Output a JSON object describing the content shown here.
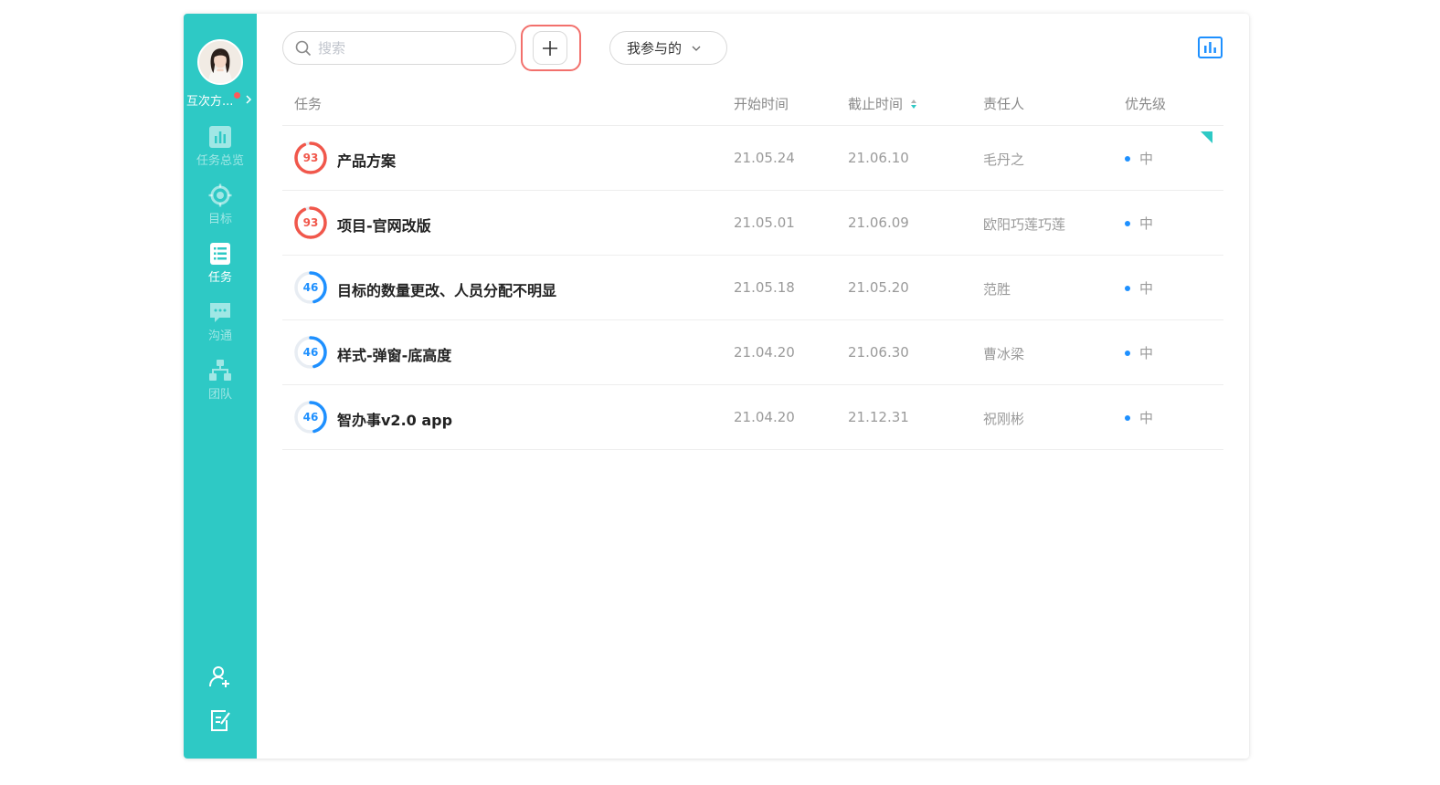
{
  "colors": {
    "sidebar": "#2ec9c5",
    "accent": "#1e90ff",
    "danger": "#f1574b",
    "highlight": "#f2706c",
    "priority_dot": "#1e90ff"
  },
  "sidebar": {
    "user_name": "互次方...",
    "nav": [
      {
        "label": "任务总览",
        "icon": "chart-icon",
        "active": false
      },
      {
        "label": "目标",
        "icon": "target-icon",
        "active": false
      },
      {
        "label": "任务",
        "icon": "task-list-icon",
        "active": true
      },
      {
        "label": "沟通",
        "icon": "chat-icon",
        "active": false
      },
      {
        "label": "团队",
        "icon": "team-icon",
        "active": false
      }
    ],
    "bottom_icons": [
      "add-person-icon",
      "edit-note-icon"
    ]
  },
  "toolbar": {
    "search_placeholder": "搜索",
    "search_value": "",
    "filter_label": "我参与的"
  },
  "table": {
    "columns": {
      "task": "任务",
      "start": "开始时间",
      "end": "截止时间",
      "owner": "责任人",
      "priority": "优先级"
    },
    "rows": [
      {
        "progress": 93,
        "progress_color": "#f1574b",
        "name": "产品方案",
        "start": "21.05.24",
        "end": "21.06.10",
        "owner": "毛丹之",
        "priority": "中"
      },
      {
        "progress": 93,
        "progress_color": "#f1574b",
        "name": "项目-官网改版",
        "start": "21.05.01",
        "end": "21.06.09",
        "owner": "欧阳巧莲巧莲",
        "priority": "中"
      },
      {
        "progress": 46,
        "progress_color": "#1e90ff",
        "name": "目标的数量更改、人员分配不明显",
        "start": "21.05.18",
        "end": "21.05.20",
        "owner": "范胜",
        "priority": "中"
      },
      {
        "progress": 46,
        "progress_color": "#1e90ff",
        "name": "样式-弹窗-底高度",
        "start": "21.04.20",
        "end": "21.06.30",
        "owner": "曹冰梁",
        "priority": "中"
      },
      {
        "progress": 46,
        "progress_color": "#1e90ff",
        "name": "智办事v2.0 app",
        "start": "21.04.20",
        "end": "21.12.31",
        "owner": "祝刚彬",
        "priority": "中"
      }
    ]
  }
}
